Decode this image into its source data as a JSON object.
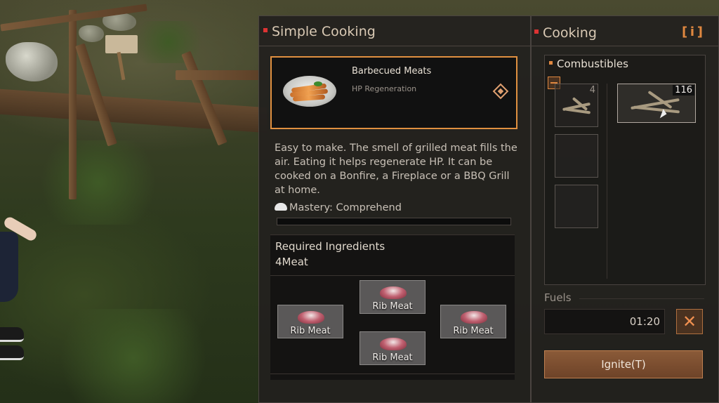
{
  "recipe_panel": {
    "title": "Simple Cooking",
    "recipe": {
      "name": "Barbecued Meats",
      "effect": "HP Regeneration"
    },
    "description": "Easy to make. The smell of grilled meat fills the air. Eating it helps regenerate HP. It can be cooked on a Bonfire, a Fireplace or a BBQ Grill at home.",
    "mastery": "Mastery: Comprehend",
    "ingredients": {
      "title": "Required Ingredients",
      "count": "4Meat",
      "items": [
        {
          "label": "Rib Meat"
        },
        {
          "label": "Rib Meat"
        },
        {
          "label": "Rib Meat"
        },
        {
          "label": "Rib Meat"
        }
      ]
    }
  },
  "cooking_panel": {
    "title": "Cooking",
    "info_label": "i",
    "combustibles": {
      "title": "Combustibles",
      "selected_count": "4",
      "inventory_count": "116"
    },
    "fuels_label": "Fuels",
    "fuel_time": "01:20",
    "cancel_label": "✕",
    "ignite_label": "Ignite(T)"
  },
  "colors": {
    "accent": "#e08840",
    "title_dot": "#dd3333",
    "panel_bg": "#22201e"
  }
}
